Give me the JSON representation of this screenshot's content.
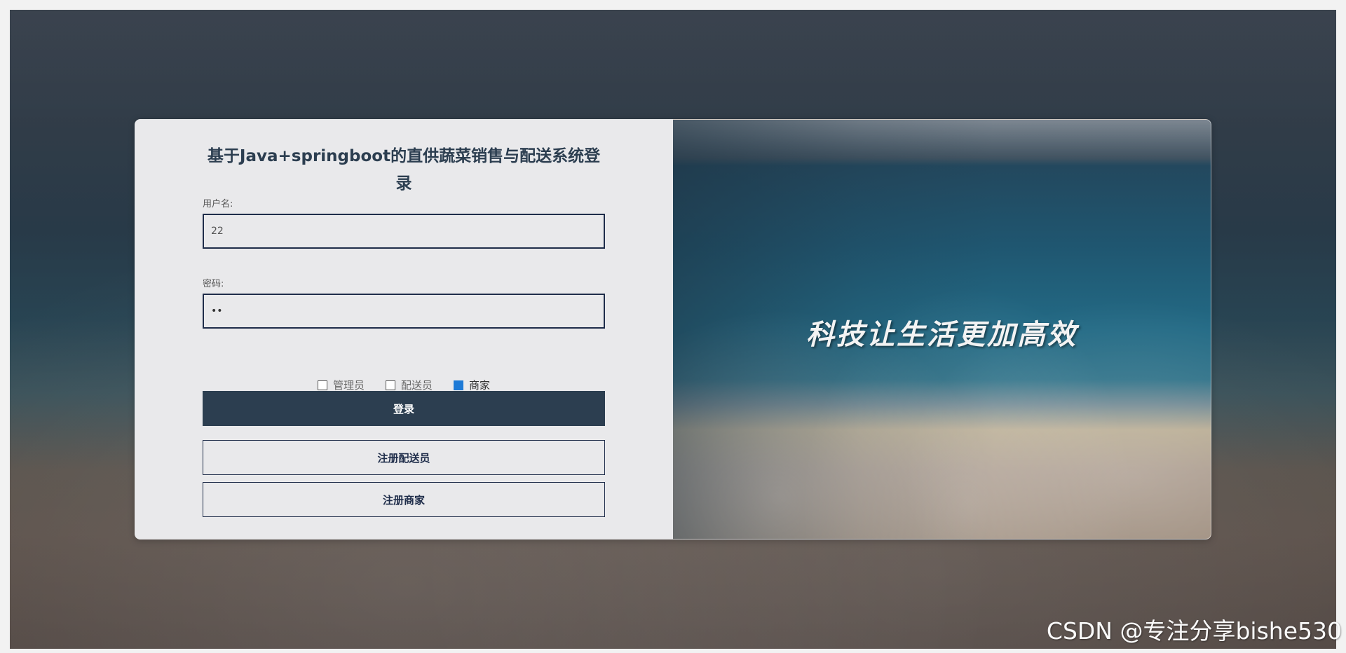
{
  "login": {
    "title": "基于Java+springboot的直供蔬菜销售与配送系统登录",
    "username_label": "用户名:",
    "username_value": "22",
    "password_label": "密码:",
    "password_value": "••",
    "roles": [
      {
        "label": "管理员",
        "checked": false
      },
      {
        "label": "配送员",
        "checked": false
      },
      {
        "label": "商家",
        "checked": true
      }
    ],
    "login_button": "登录",
    "register_courier_button": "注册配送员",
    "register_merchant_button": "注册商家"
  },
  "banner": {
    "slogan": "科技让生活更加高效"
  },
  "watermark": "CSDN @专注分享bishe530",
  "colors": {
    "primary": "#2c3e50",
    "input_border": "#1f2d4a",
    "panel_bg": "#e9e9eb",
    "checkbox_checked": "#1e7ad6"
  }
}
